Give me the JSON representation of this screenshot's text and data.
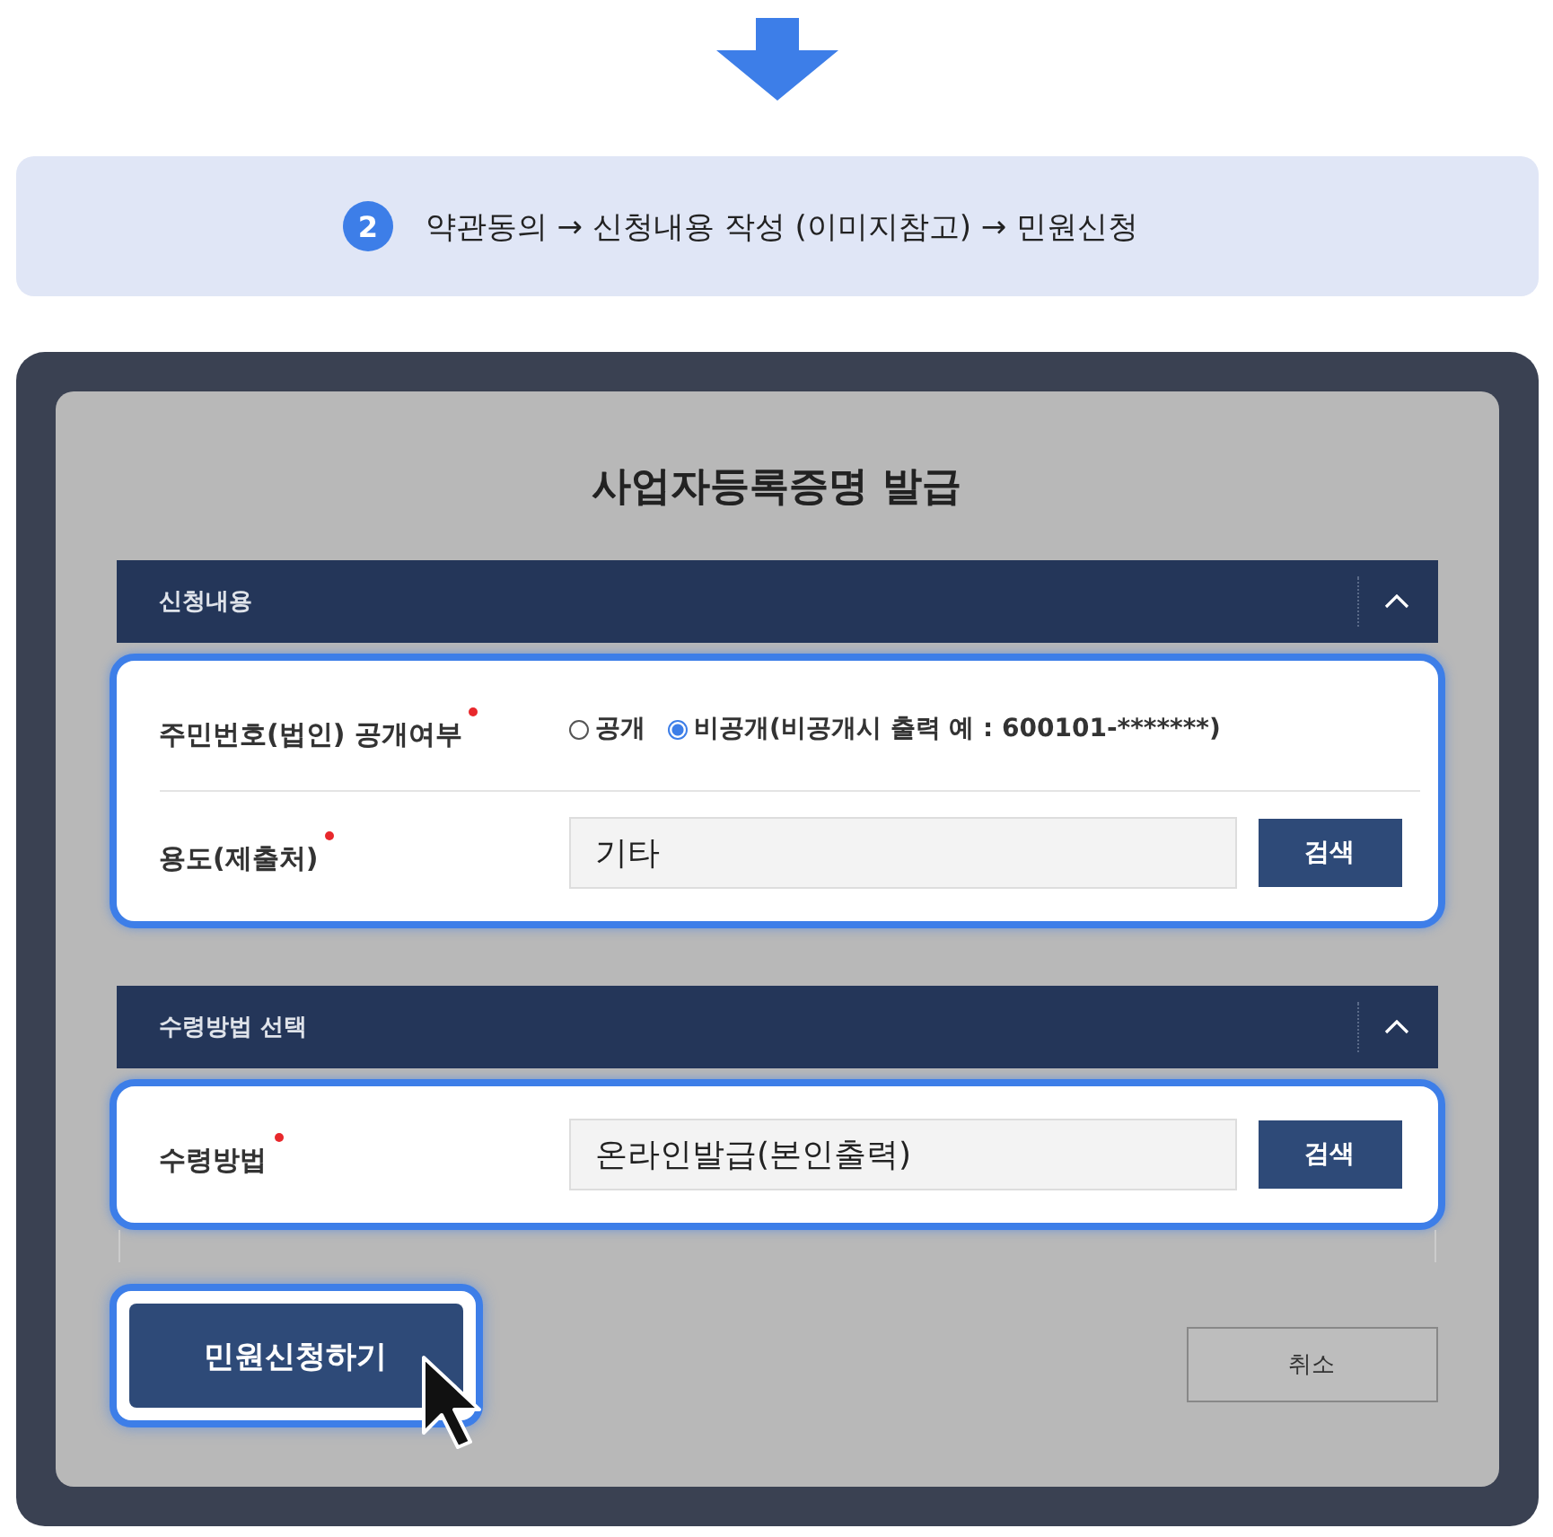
{
  "step": {
    "number": "2",
    "text": "약관동의 → 신청내용 작성 (이미지참고) → 민원신청"
  },
  "dialog": {
    "title": "사업자등록증명 발급",
    "sections": [
      {
        "header": "신청내용",
        "expanded": true,
        "highlighted": true,
        "rows": [
          {
            "kind": "radio",
            "label": "주민번호(법인) 공개여부",
            "required": true,
            "options": [
              {
                "label": "공개",
                "selected": false
              },
              {
                "label": "비공개(비공개시 출력 예 : 600101-*******)",
                "selected": true
              }
            ]
          },
          {
            "kind": "field",
            "label": "용도(제출처)",
            "required": true,
            "value": "기타",
            "button": "검색"
          }
        ]
      },
      {
        "header": "수령방법 선택",
        "expanded": true,
        "highlighted": true,
        "rows": [
          {
            "kind": "field",
            "label": "수령방법",
            "required": true,
            "value": "온라인발급(본인출력)",
            "button": "검색"
          }
        ]
      }
    ],
    "submit": {
      "label": "민원신청하기",
      "highlighted": true
    },
    "cancel": {
      "label": "취소"
    }
  }
}
